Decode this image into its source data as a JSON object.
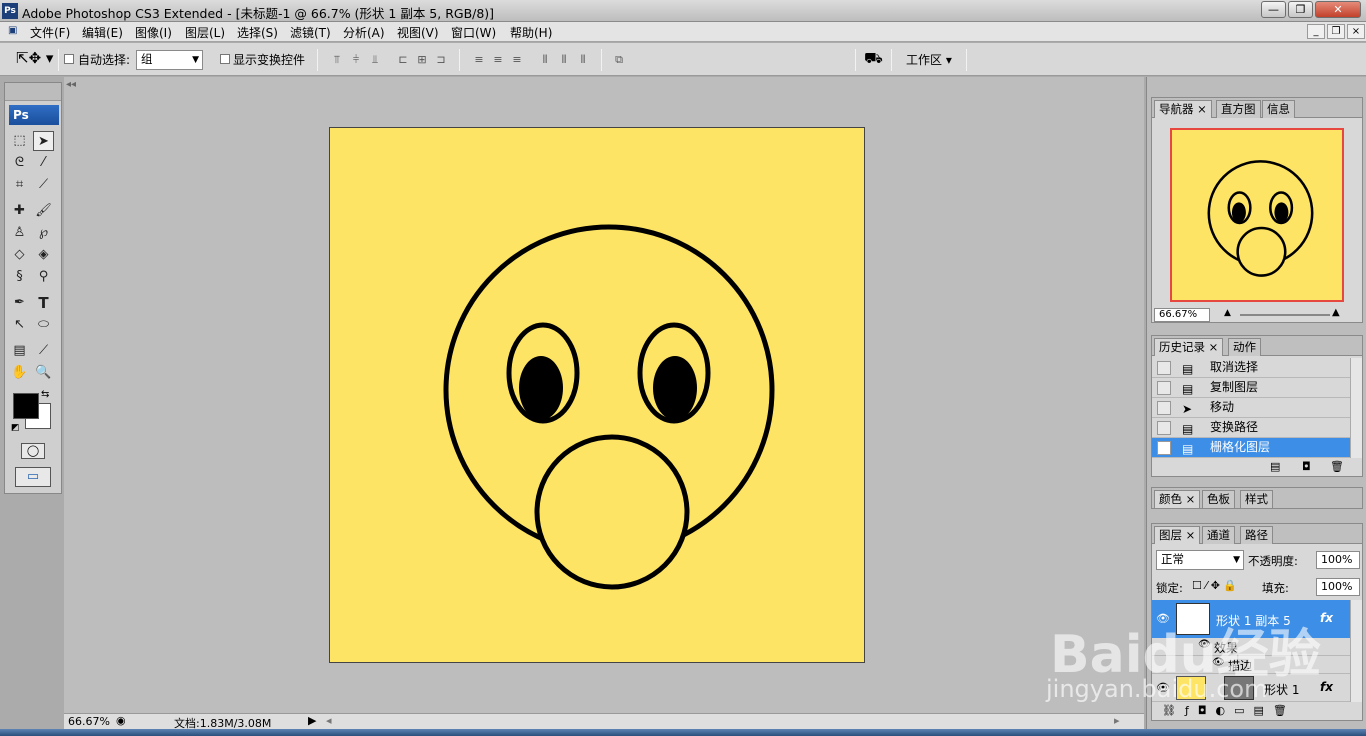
{
  "titlebar": {
    "app_icon": "Ps",
    "title": "Adobe Photoshop CS3 Extended - [未标题-1 @ 66.7% (形状 1 副本 5, RGB/8)]",
    "minimize": "—",
    "maximize": "❐",
    "close": "✕"
  },
  "menu": {
    "items": [
      "文件(F)",
      "编辑(E)",
      "图像(I)",
      "图层(L)",
      "选择(S)",
      "滤镜(T)",
      "分析(A)",
      "视图(V)",
      "窗口(W)",
      "帮助(H)"
    ],
    "doc_min": "_",
    "doc_restore": "❐",
    "doc_close": "×"
  },
  "options": {
    "auto_select_label": "自动选择:",
    "auto_select_value": "组",
    "show_transform_label": "显示变换控件",
    "workspace_label": "工作区"
  },
  "toolbox": {
    "header": "Ps",
    "icons": [
      "marquee-icon",
      "move-icon",
      "lasso-icon",
      "magic-wand-icon",
      "crop-icon",
      "slice-icon",
      "healing-icon",
      "brush-icon",
      "stamp-icon",
      "history-brush-icon",
      "eraser-icon",
      "paint-bucket-icon",
      "blur-icon",
      "dodge-icon",
      "pen-icon",
      "type-icon",
      "path-select-icon",
      "ellipse-icon",
      "notes-icon",
      "eyedropper-icon",
      "hand-icon",
      "zoom-icon"
    ],
    "foreground_color": "#000000",
    "background_color": "#ffffff"
  },
  "canvas": {
    "background": "#fde465",
    "stroke": "#000000"
  },
  "status": {
    "zoom": "66.67%",
    "doc_info": "文档:1.83M/3.08M"
  },
  "navigator": {
    "tabs": [
      "导航器",
      "直方图",
      "信息"
    ],
    "zoom": "66.67%",
    "frame_color": "#e6473e"
  },
  "history": {
    "tabs": [
      "历史记录",
      "动作"
    ],
    "items": [
      "取消选择",
      "复制图层",
      "移动",
      "变换路径",
      "栅格化图层"
    ],
    "selected_index": 4
  },
  "color_panel": {
    "tabs": [
      "颜色",
      "色板",
      "样式"
    ]
  },
  "layers": {
    "tabs": [
      "图层",
      "通道",
      "路径"
    ],
    "blend_mode": "正常",
    "opacity_label": "不透明度:",
    "opacity": "100%",
    "lock_label": "锁定:",
    "fill_label": "填充:",
    "fill": "100%",
    "active_layer": "形状 1 副本 5",
    "effects_label": "效果",
    "stroke_label": "描边",
    "layer2": "形状 1",
    "fx": "fx"
  },
  "watermark": {
    "brand": "Baidu经验",
    "url": "jingyan.baidu.com"
  }
}
